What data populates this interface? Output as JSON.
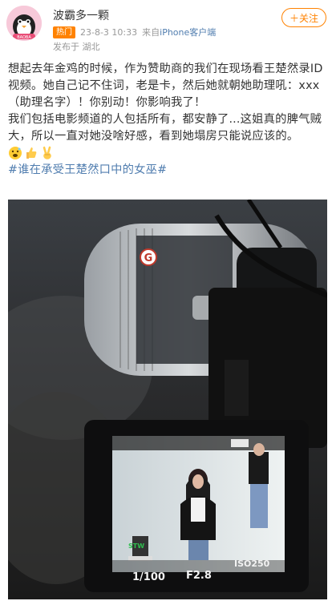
{
  "header": {
    "username": "波霸多一颗",
    "hot_label": "热门",
    "date": "23-8-3 10:33",
    "source_prefix": "来自",
    "source_name": "iPhone客户端",
    "location": "发布于 湖北",
    "follow_label": "＋关注",
    "avatar_label": "BAOBA"
  },
  "post": {
    "para1": "想起去年金鸡的时候，作为赞助商的我们在现场看王楚然录ID视频。她自己记不住词，老是卡，然后她就朝她助理吼：xxx（助理名字）！你别动！你影响我了！",
    "para2": "我们包括电影频道的人包括所有，都安静了...这姐真的脾气贼大，所以一直对她没啥好感，看到她塌房只能说应该的。",
    "topic": "#谁在承受王楚然口中的女巫#",
    "emojis": [
      "grimace-emoji",
      "thumbs-up-emoji",
      "victory-hand-emoji"
    ]
  },
  "photo": {
    "lens_badge": "G",
    "shutter": "1/100",
    "aperture": "F2.8",
    "iso": "ISO250",
    "screen_mark": "STW"
  },
  "colors": {
    "accent": "#ff8200",
    "link": "#507daf",
    "text": "#333333",
    "meta": "#999999"
  }
}
